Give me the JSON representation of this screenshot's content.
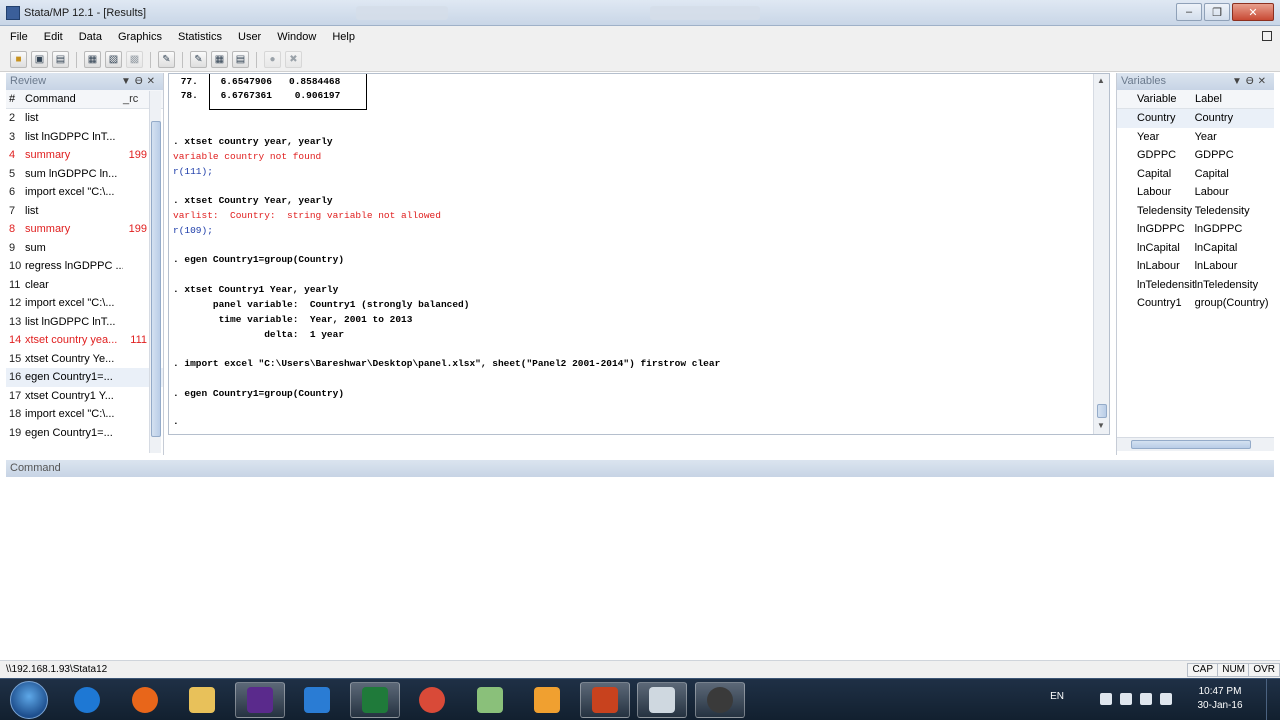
{
  "window": {
    "title": "Stata/MP 12.1 - [Results]"
  },
  "menu": [
    "File",
    "Edit",
    "Data",
    "Graphics",
    "Statistics",
    "User",
    "Window",
    "Help"
  ],
  "toolbar": {
    "icons": [
      "open-icon",
      "save-icon",
      "print-icon",
      "log-icon",
      "viewer-icon",
      "graph-icon",
      "do-file-editor-icon",
      "data-editor-icon",
      "data-browser-icon",
      "variables-manager-icon",
      "more-icon",
      "break-icon"
    ]
  },
  "review": {
    "title": "Review",
    "col_num": "#",
    "col_command": "Command",
    "col_rc": "_rc",
    "rows": [
      {
        "num": "2",
        "cmd": "list",
        "rc": "",
        "error": false
      },
      {
        "num": "3",
        "cmd": "list lnGDPPC lnT...",
        "rc": "",
        "error": false
      },
      {
        "num": "4",
        "cmd": "summary",
        "rc": "199",
        "error": true
      },
      {
        "num": "5",
        "cmd": "sum lnGDPPC ln...",
        "rc": "",
        "error": false
      },
      {
        "num": "6",
        "cmd": "import excel \"C:\\...",
        "rc": "",
        "error": false
      },
      {
        "num": "7",
        "cmd": "list",
        "rc": "",
        "error": false
      },
      {
        "num": "8",
        "cmd": "summary",
        "rc": "199",
        "error": true
      },
      {
        "num": "9",
        "cmd": "sum",
        "rc": "",
        "error": false
      },
      {
        "num": "10",
        "cmd": "regress lnGDPPC ...",
        "rc": "",
        "error": false
      },
      {
        "num": "11",
        "cmd": "clear",
        "rc": "",
        "error": false
      },
      {
        "num": "12",
        "cmd": "import excel \"C:\\...",
        "rc": "",
        "error": false
      },
      {
        "num": "13",
        "cmd": "list lnGDPPC lnT...",
        "rc": "",
        "error": false
      },
      {
        "num": "14",
        "cmd": "xtset country yea...",
        "rc": "111",
        "error": true
      },
      {
        "num": "15",
        "cmd": "xtset Country Ye...",
        "rc": "",
        "error": false
      },
      {
        "num": "16",
        "cmd": "egen Country1=...",
        "rc": "",
        "error": false
      },
      {
        "num": "17",
        "cmd": "xtset Country1 Y...",
        "rc": "",
        "error": false
      },
      {
        "num": "18",
        "cmd": "import excel \"C:\\...",
        "rc": "",
        "error": false
      },
      {
        "num": "19",
        "cmd": "egen Country1=...",
        "rc": "",
        "error": false
      }
    ]
  },
  "results": {
    "lines": [
      {
        "text": " 77.    6.6547906   0.8584468",
        "kind": "table"
      },
      {
        "text": " 78.    6.6767361    0.906197",
        "kind": "table"
      },
      {
        "text": ". xtset country year, yearly",
        "kind": "cmd"
      },
      {
        "text": "variable country not found",
        "kind": "err"
      },
      {
        "text": "r(111);",
        "kind": "rc"
      },
      {
        "text": ". xtset Country Year, yearly",
        "kind": "cmd"
      },
      {
        "text": "varlist:  Country:  string variable not allowed",
        "kind": "err"
      },
      {
        "text": "r(109);",
        "kind": "rc"
      },
      {
        "text": ". egen Country1=group(Country)",
        "kind": "cmd"
      },
      {
        "text": ". xtset Country1 Year, yearly",
        "kind": "cmd"
      },
      {
        "text": "       panel variable:  Country1 (strongly balanced)",
        "kind": "cmd"
      },
      {
        "text": "        time variable:  Year, 2001 to 2013",
        "kind": "cmd"
      },
      {
        "text": "                delta:  1 year",
        "kind": "cmd"
      },
      {
        "text": ". import excel \"C:\\Users\\Bareshwar\\Desktop\\panel.xlsx\", sheet(\"Panel2 2001-2014\") firstrow clear",
        "kind": "cmd"
      },
      {
        "text": ". egen Country1=group(Country)",
        "kind": "cmd"
      },
      {
        "text": ".",
        "kind": "cmd"
      }
    ]
  },
  "variables": {
    "title": "Variables",
    "col_variable": "Variable",
    "col_label": "Label",
    "rows": [
      {
        "name": "Country",
        "label": "Country"
      },
      {
        "name": "Year",
        "label": "Year"
      },
      {
        "name": "GDPPC",
        "label": "GDPPC"
      },
      {
        "name": "Capital",
        "label": "Capital"
      },
      {
        "name": "Labour",
        "label": "Labour"
      },
      {
        "name": "Teledensity",
        "label": "Teledensity"
      },
      {
        "name": "lnGDPPC",
        "label": "lnGDPPC"
      },
      {
        "name": "lnCapital",
        "label": "lnCapital"
      },
      {
        "name": "lnLabour",
        "label": "lnLabour"
      },
      {
        "name": "lnTeledensity",
        "label": "lnTeledensity"
      },
      {
        "name": "Country1",
        "label": "group(Country)"
      }
    ]
  },
  "command": {
    "title": "Command",
    "value": ""
  },
  "status": {
    "path": "\\\\192.168.1.93\\Stata12",
    "indicators": [
      "CAP",
      "NUM",
      "OVR"
    ]
  },
  "taskbar": {
    "lang": "EN",
    "time": "10:47 PM",
    "date": "30-Jan-16",
    "colors": {
      "ie": "#1e78d4",
      "firefox": "#e8661a",
      "explorer": "#e8c15a",
      "stata": "#5a2a8c",
      "download": "#2a7cd4",
      "excel": "#1f7a3a",
      "chrome": "#d94a38",
      "folder": "#8ac07a",
      "media": "#f0a030",
      "powerpoint": "#c8421e",
      "calc": "#cfd8e0",
      "camera": "#3a3a3a"
    }
  }
}
